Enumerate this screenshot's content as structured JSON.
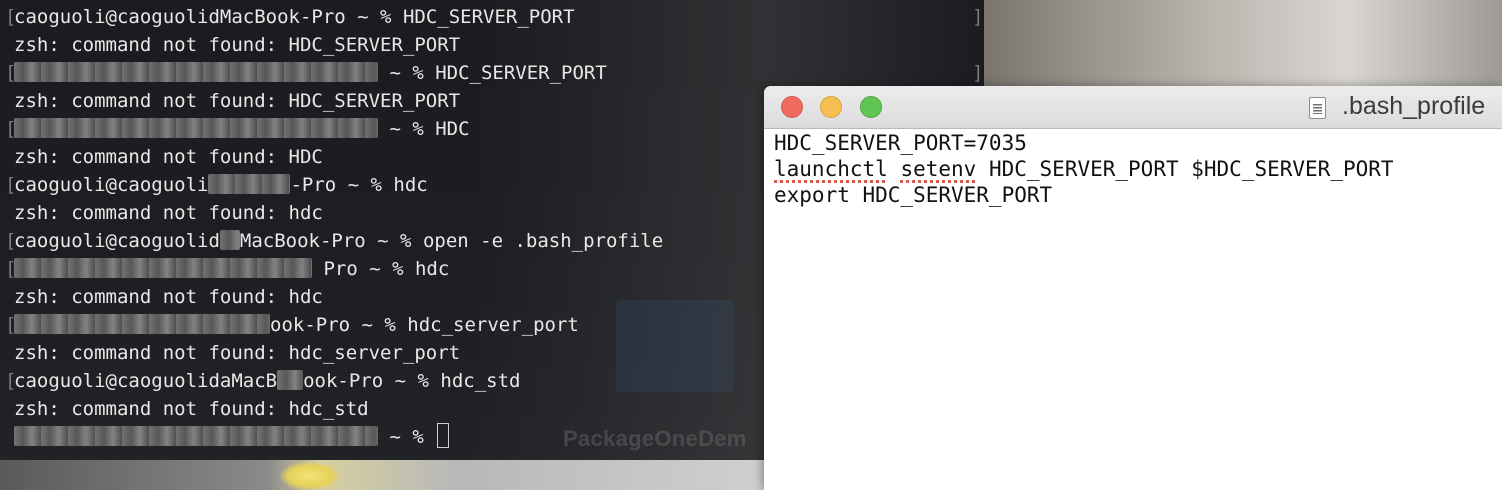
{
  "terminal": {
    "lines": [
      {
        "prompt_visible": "caoguoli@caoguolidMacBook-Pro ~ % ",
        "command": "HDC_SERVER_PORT",
        "blurred": false
      },
      {
        "output": "zsh: command not found: HDC_SERVER_PORT"
      },
      {
        "prompt_suffix": " ~ % ",
        "command": "HDC_SERVER_PORT",
        "blurred": true
      },
      {
        "output": "zsh: command not found: HDC_SERVER_PORT"
      },
      {
        "prompt_suffix": " ~ % ",
        "command": "HDC",
        "blurred": true
      },
      {
        "output": "zsh: command not found: HDC"
      },
      {
        "prompt_visible": "caoguoli@caoguoli",
        "prompt_tail": "-Pro ~ % ",
        "command": "hdc"
      },
      {
        "output": "zsh: command not found: hdc"
      },
      {
        "prompt_visible": "caoguoli@caoguolid",
        "prompt_tail": "MacBook-Pro ~ % ",
        "command": "open -e .bash_profile"
      },
      {
        "prompt_suffix": " Pro ~ % ",
        "command": "hdc",
        "blurred": true
      },
      {
        "output": "zsh: command not found: hdc"
      },
      {
        "prompt_tail": "ook-Pro ~ % ",
        "command": "hdc_server_port"
      },
      {
        "output": "zsh: command not found: hdc_server_port"
      },
      {
        "prompt_visible": "caoguoli@caoguolidaMacB",
        "prompt_tail": "ook-Pro ~ % ",
        "command": "hdc_std"
      },
      {
        "output": "zsh: command not found: hdc_std"
      },
      {
        "prompt_suffix": " ~ % ",
        "command": ""
      }
    ],
    "text": {
      "l1_prompt": "caoguoli@caoguolidMacBook-Pro ~ % ",
      "l1_cmd": "HDC_SERVER_PORT",
      "l2_out": "zsh: command not found: HDC_SERVER_PORT",
      "l3_tail": " ~ % ",
      "l3_cmd": "HDC_SERVER_PORT",
      "l4_out": "zsh: command not found: HDC_SERVER_PORT",
      "l5_tail": " ~ % ",
      "l5_cmd": "HDC",
      "l6_out": "zsh: command not found: HDC",
      "l7_prompt": "caoguoli@caoguoli",
      "l7_tail": "-Pro ~ % ",
      "l7_cmd": "hdc",
      "l8_out": "zsh: command not found: hdc",
      "l9_prompt": "caoguoli@caoguolid",
      "l9_tail": "MacBook-Pro ~ % ",
      "l9_cmd": "open -e .bash_profile",
      "l10_tail": " Pro ~ % ",
      "l10_cmd": "hdc",
      "l11_out": "zsh: command not found: hdc",
      "l12_tail": "ook-Pro ~ % ",
      "l12_cmd": "hdc_server_port",
      "l13_out": "zsh: command not found: hdc_server_port",
      "l14_prompt": "caoguoli@caoguolidaMacB",
      "l14_tail": "ook-Pro ~ % ",
      "l14_cmd": "hdc_std",
      "l15_out": "zsh: command not found: hdc_std",
      "l16_tail": " ~ % "
    },
    "background_label": "PackageOneDem"
  },
  "editor": {
    "title": ".bash_profile",
    "lines": [
      "HDC_SERVER_PORT=7035",
      "launchctl setenv HDC_SERVER_PORT $HDC_SERVER_PORT",
      "export HDC_SERVER_PORT"
    ],
    "line2": {
      "w1": "launchctl",
      "w2": "setenv",
      "rest": " HDC_SERVER_PORT $HDC_SERVER_PORT"
    },
    "misspelled_words": [
      "launchctl",
      "setenv"
    ]
  },
  "colors": {
    "terminal_bg": "#14161a",
    "terminal_text": "#e8e8e8",
    "editor_bg": "#ffffff",
    "close_light": "#ee6a5f",
    "minimize_light": "#f5bf4f",
    "zoom_light": "#61c554",
    "spellcheck_underline": "#e0574d"
  }
}
